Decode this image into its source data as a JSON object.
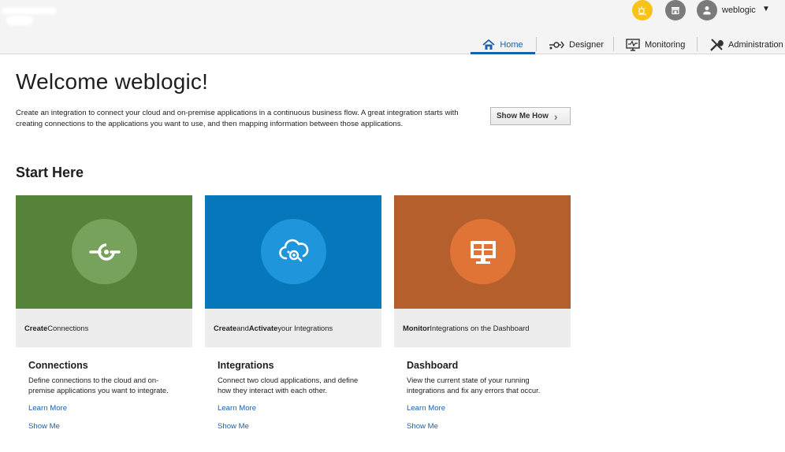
{
  "header": {
    "user": {
      "name": "weblogic",
      "caret": "▼"
    },
    "icons": [
      "notifications-sun-icon",
      "store-icon",
      "user-avatar-icon"
    ],
    "nav": [
      {
        "label": "Home",
        "icon": "home-icon",
        "active": true
      },
      {
        "label": "Designer",
        "icon": "designer-icon"
      },
      {
        "label": "Monitoring",
        "icon": "monitoring-icon"
      },
      {
        "label": "Administration",
        "icon": "administration-icon"
      }
    ]
  },
  "main": {
    "welcome": "Welcome weblogic!",
    "intro": "Create an integration to connect your cloud and on-premise applications in a continuous business flow. A great integration starts with creating connections to the applications you want to use, and then mapping information between those applications.",
    "show_me_how": "Show Me How",
    "start_here": "Start Here"
  },
  "cards": [
    {
      "icon": "connection-icon",
      "color": "#55833a",
      "sub_bold": "Create",
      "sub_rest": " Connections",
      "title": "Connections",
      "desc": "Define connections to the cloud and on-premise applications you want to integrate.",
      "learn_more": "Learn More",
      "show_me": "Show Me"
    },
    {
      "icon": "cloud-integration-icon",
      "color": "#0677ba",
      "sub_bold": "Create",
      "sub_mid": " and ",
      "sub_bold2": "Activate",
      "sub_rest": " your Integrations",
      "title": "Integrations",
      "desc": "Connect two cloud applications, and define how they interact with each other.",
      "learn_more": "Learn More",
      "show_me": "Show Me"
    },
    {
      "icon": "dashboard-monitor-icon",
      "color": "#b5602c",
      "sub_bold": "Monitor",
      "sub_rest": " Integrations on the Dashboard",
      "title": "Dashboard",
      "desc": "View the current state of your running integrations and fix any errors that occur.",
      "learn_more": "Learn More",
      "show_me": "Show Me"
    }
  ]
}
